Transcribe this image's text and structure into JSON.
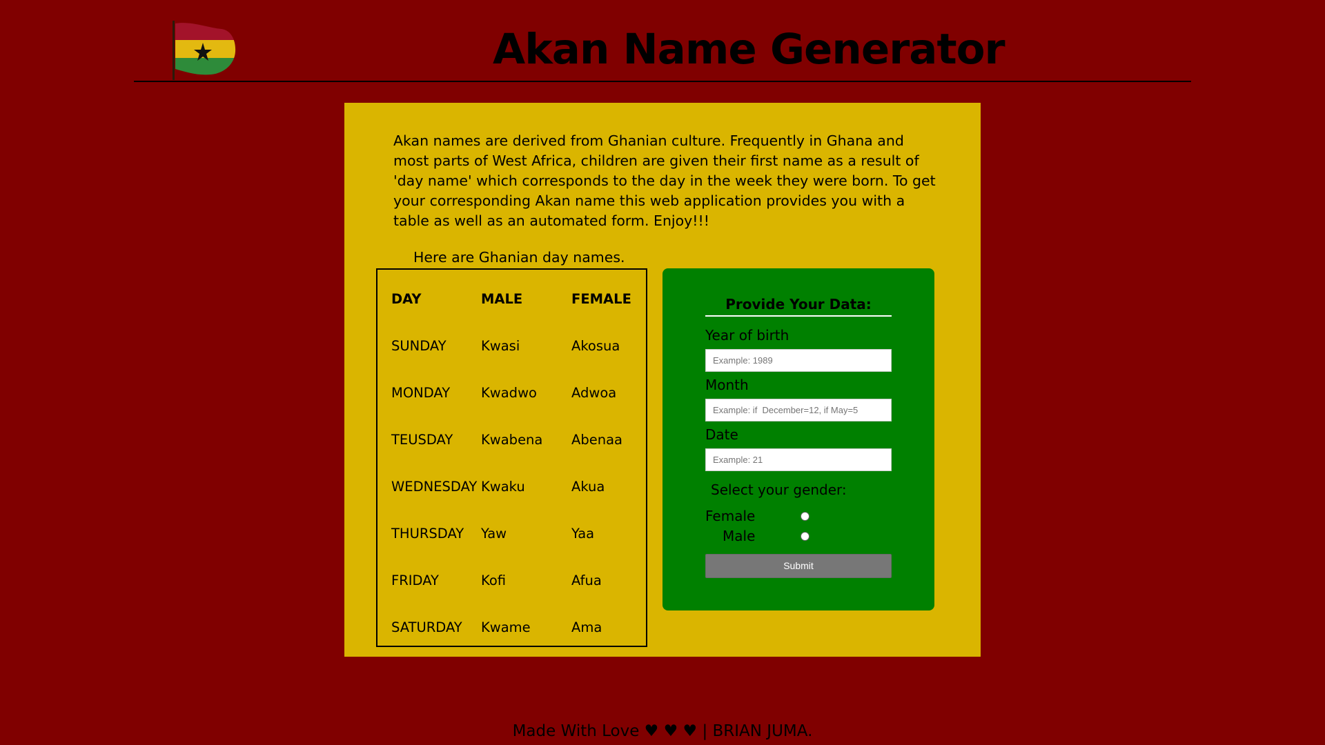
{
  "header": {
    "title": "Akan Name Generator",
    "logo_icon": "ghana-flag-icon"
  },
  "intro": {
    "text": "Akan names are derived from Ghanian culture. Frequently in Ghana and most parts of West Africa, children are given their first name as a result of 'day name' which corresponds to the day in the week they were born. To get your corresponding Akan name this web application provides you with a table as well as an automated form. Enjoy!!!"
  },
  "table": {
    "caption": "Here are Ghanian day names.",
    "headers": [
      "DAY",
      "MALE",
      "FEMALE"
    ],
    "rows": [
      [
        "SUNDAY",
        "Kwasi",
        "Akosua"
      ],
      [
        "MONDAY",
        "Kwadwo",
        "Adwoa"
      ],
      [
        "TEUSDAY",
        "Kwabena",
        "Abenaa"
      ],
      [
        "WEDNESDAY",
        "Kwaku",
        "Akua"
      ],
      [
        "THURSDAY",
        "Yaw",
        "Yaa"
      ],
      [
        "FRIDAY",
        "Kofi",
        "Afua"
      ],
      [
        "SATURDAY",
        "Kwame",
        "Ama"
      ]
    ]
  },
  "form": {
    "title": "Provide Your Data:",
    "year_label": "Year of birth",
    "year_placeholder": "Example: 1989",
    "month_label": "Month",
    "month_placeholder": "Example: if  December=12, if May=5",
    "date_label": "Date",
    "date_placeholder": "Example: 21",
    "gender_label": "Select your gender:",
    "female_label": "Female",
    "male_label": "Male",
    "submit_label": "Submit"
  },
  "footer": {
    "text": "Made With Love ♥ ♥ ♥  | BRIAN JUMA."
  },
  "colors": {
    "background": "#800000",
    "panel": "#DAB500",
    "form_panel": "#008000",
    "button": "#777777"
  }
}
